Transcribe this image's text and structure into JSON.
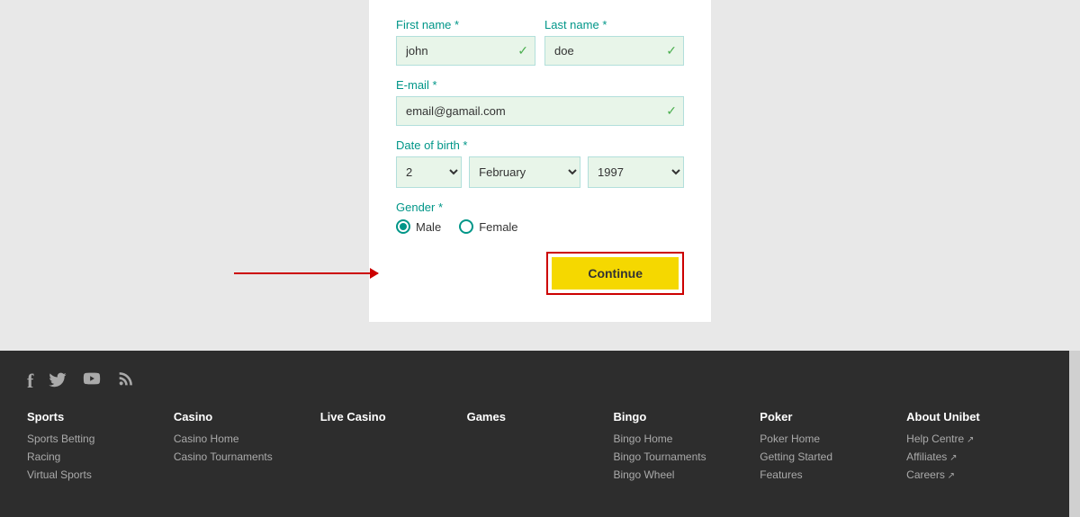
{
  "form": {
    "first_name_label": "First name *",
    "last_name_label": "Last name *",
    "email_label": "E-mail *",
    "dob_label": "Date of birth *",
    "gender_label": "Gender *",
    "first_name_value": "john",
    "last_name_value": "doe",
    "email_value": "email@gamail.com",
    "dob_day": "2",
    "dob_month": "February",
    "dob_year": "1997",
    "gender_male": "Male",
    "gender_female": "Female",
    "continue_label": "Continue"
  },
  "footer": {
    "social_icons": [
      "f",
      "𝕏",
      "▶",
      "◉"
    ],
    "columns": [
      {
        "header": "Sports",
        "links": [
          "Sports Betting",
          "Racing",
          "Virtual Sports"
        ]
      },
      {
        "header": "Casino",
        "links": [
          "Casino Home",
          "Casino Tournaments"
        ]
      },
      {
        "header": "Live Casino",
        "links": []
      },
      {
        "header": "Games",
        "links": []
      },
      {
        "header": "Bingo",
        "links": [
          "Bingo Home",
          "Bingo Tournaments",
          "Bingo Wheel"
        ]
      },
      {
        "header": "Poker",
        "links": [
          "Poker Home",
          "Getting Started",
          "Features"
        ]
      },
      {
        "header": "About Unibet",
        "links": [
          "Help Centre ↗",
          "Affiliates ↗",
          "Careers ↗"
        ]
      }
    ]
  }
}
